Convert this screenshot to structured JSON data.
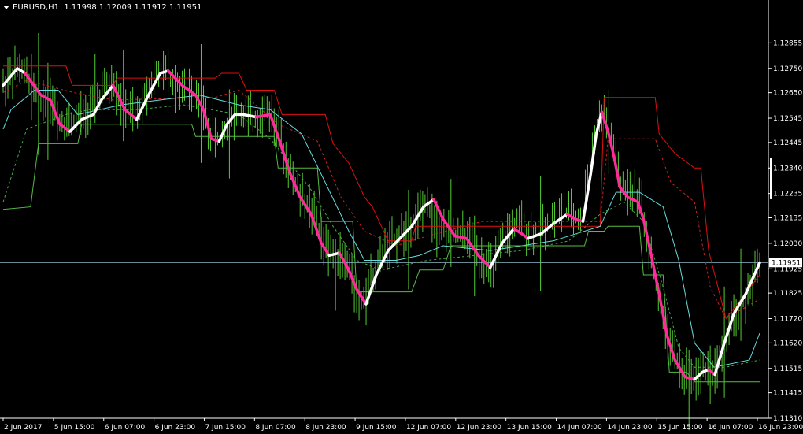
{
  "header": {
    "symbol": "EURUSD,H1",
    "ohlc": "1.11998 1.12009 1.11912 1.11951"
  },
  "colors": {
    "background": "#000000",
    "axis": "#ffffff",
    "bars": "#55cc33",
    "hline": "#8fb8c8",
    "upper_band": "#dd1111",
    "upper_mid": "#cc2222",
    "mid_band": "#66dddd",
    "lower_mid": "#44aa44",
    "lower_band": "#55bb44",
    "trend_down": "#ff2a9a",
    "trend_up": "#ffffff",
    "price_tag_bg": "#ffffff"
  },
  "chart_data": {
    "type": "line",
    "xlim": [
      0,
      966
    ],
    "ylim": [
      1.1131,
      1.1296
    ],
    "y_ticks": [
      "1.12855",
      "1.12750",
      "1.12650",
      "1.12545",
      "1.12445",
      "1.12340",
      "1.12235",
      "1.12135",
      "1.12030",
      "1.11925",
      "1.11825",
      "1.11720",
      "1.11620",
      "1.11515",
      "1.11415",
      "1.11310"
    ],
    "x_ticks": [
      {
        "x": 0,
        "label": "2 Jun 2017"
      },
      {
        "x": 64,
        "label": "5 Jun 15:00"
      },
      {
        "x": 128,
        "label": "6 Jun 07:00"
      },
      {
        "x": 192,
        "label": "6 Jun 23:00"
      },
      {
        "x": 256,
        "label": "7 Jun 15:00"
      },
      {
        "x": 320,
        "label": "8 Jun 07:00"
      },
      {
        "x": 384,
        "label": "8 Jun 23:00"
      },
      {
        "x": 448,
        "label": "9 Jun 15:00"
      },
      {
        "x": 512,
        "label": "12 Jun 07:00"
      },
      {
        "x": 576,
        "label": "12 Jun 23:00"
      },
      {
        "x": 640,
        "label": "13 Jun 15:00"
      },
      {
        "x": 704,
        "label": "14 Jun 07:00"
      },
      {
        "x": 768,
        "label": "14 Jun 23:00"
      },
      {
        "x": 832,
        "label": "15 Jun 15:00"
      },
      {
        "x": 896,
        "label": "16 Jun 07:00"
      },
      {
        "x": 960,
        "label": "16 Jun 23:00"
      }
    ],
    "current_price": 1.11951,
    "current_price_label": "1.11951",
    "price_path": [
      [
        0,
        1.1268
      ],
      [
        18,
        1.1275
      ],
      [
        30,
        1.1272
      ],
      [
        48,
        1.1262
      ],
      [
        60,
        1.1262
      ],
      [
        70,
        1.1254
      ],
      [
        85,
        1.1252
      ],
      [
        100,
        1.1256
      ],
      [
        115,
        1.126
      ],
      [
        125,
        1.1265
      ],
      [
        140,
        1.1268
      ],
      [
        155,
        1.1258
      ],
      [
        170,
        1.1256
      ],
      [
        185,
        1.1268
      ],
      [
        200,
        1.1274
      ],
      [
        212,
        1.1272
      ],
      [
        228,
        1.1266
      ],
      [
        240,
        1.1266
      ],
      [
        252,
        1.1262
      ],
      [
        262,
        1.1248
      ],
      [
        275,
        1.1245
      ],
      [
        290,
        1.1256
      ],
      [
        305,
        1.1256
      ],
      [
        320,
        1.1254
      ],
      [
        340,
        1.1258
      ],
      [
        350,
        1.1248
      ],
      [
        365,
        1.1233
      ],
      [
        378,
        1.1222
      ],
      [
        392,
        1.1218
      ],
      [
        405,
        1.1205
      ],
      [
        415,
        1.1199
      ],
      [
        425,
        1.1199
      ],
      [
        440,
        1.1192
      ],
      [
        455,
        1.1178
      ],
      [
        470,
        1.119
      ],
      [
        485,
        1.12
      ],
      [
        500,
        1.1205
      ],
      [
        515,
        1.121
      ],
      [
        535,
        1.1218
      ],
      [
        550,
        1.1214
      ],
      [
        565,
        1.1208
      ],
      [
        580,
        1.1206
      ],
      [
        595,
        1.1205
      ],
      [
        610,
        1.1196
      ],
      [
        622,
        1.1192
      ],
      [
        640,
        1.1206
      ],
      [
        655,
        1.1212
      ],
      [
        668,
        1.1208
      ],
      [
        680,
        1.1208
      ],
      [
        695,
        1.1212
      ],
      [
        710,
        1.1216
      ],
      [
        725,
        1.1215
      ],
      [
        735,
        1.1212
      ],
      [
        745,
        1.1232
      ],
      [
        755,
        1.125
      ],
      [
        765,
        1.1257
      ],
      [
        775,
        1.1245
      ],
      [
        785,
        1.1226
      ],
      [
        800,
        1.1225
      ],
      [
        812,
        1.122
      ],
      [
        822,
        1.12
      ],
      [
        835,
        1.118
      ],
      [
        850,
        1.116
      ],
      [
        865,
        1.115
      ],
      [
        880,
        1.1148
      ],
      [
        895,
        1.1152
      ],
      [
        905,
        1.115
      ],
      [
        918,
        1.1162
      ],
      [
        935,
        1.1175
      ],
      [
        950,
        1.1183
      ],
      [
        963,
        1.1195
      ]
    ],
    "trend_segments": [
      {
        "dir": "up",
        "points": [
          [
            0,
            1.1268
          ],
          [
            18,
            1.1275
          ],
          [
            28,
            1.1273
          ]
        ]
      },
      {
        "dir": "down",
        "points": [
          [
            28,
            1.1273
          ],
          [
            48,
            1.1264
          ],
          [
            60,
            1.1262
          ],
          [
            72,
            1.1252
          ],
          [
            85,
            1.1249
          ]
        ]
      },
      {
        "dir": "up",
        "points": [
          [
            85,
            1.1249
          ],
          [
            100,
            1.1254
          ],
          [
            115,
            1.1256
          ],
          [
            125,
            1.1262
          ],
          [
            140,
            1.1268
          ]
        ]
      },
      {
        "dir": "down",
        "points": [
          [
            140,
            1.1268
          ],
          [
            155,
            1.1258
          ],
          [
            170,
            1.1254
          ]
        ]
      },
      {
        "dir": "up",
        "points": [
          [
            170,
            1.1254
          ],
          [
            185,
            1.1264
          ],
          [
            200,
            1.1273
          ],
          [
            210,
            1.1274
          ]
        ]
      },
      {
        "dir": "down",
        "points": [
          [
            210,
            1.1274
          ],
          [
            228,
            1.1268
          ],
          [
            245,
            1.1264
          ],
          [
            255,
            1.1258
          ],
          [
            265,
            1.1246
          ],
          [
            275,
            1.1245
          ]
        ]
      },
      {
        "dir": "up",
        "points": [
          [
            275,
            1.1245
          ],
          [
            285,
            1.1252
          ],
          [
            295,
            1.1256
          ],
          [
            305,
            1.1256
          ],
          [
            322,
            1.1255
          ]
        ]
      },
      {
        "dir": "down",
        "points": [
          [
            322,
            1.1255
          ],
          [
            340,
            1.1256
          ],
          [
            352,
            1.1245
          ],
          [
            365,
            1.1232
          ],
          [
            378,
            1.1222
          ],
          [
            392,
            1.1215
          ],
          [
            405,
            1.1203
          ],
          [
            415,
            1.1198
          ]
        ]
      },
      {
        "dir": "up",
        "points": [
          [
            415,
            1.1198
          ],
          [
            428,
            1.1199
          ]
        ]
      },
      {
        "dir": "down",
        "points": [
          [
            428,
            1.1199
          ],
          [
            440,
            1.1192
          ],
          [
            450,
            1.1184
          ],
          [
            462,
            1.1178
          ]
        ]
      },
      {
        "dir": "up",
        "points": [
          [
            462,
            1.1178
          ],
          [
            475,
            1.119
          ],
          [
            490,
            1.12
          ],
          [
            505,
            1.1205
          ],
          [
            520,
            1.121
          ],
          [
            535,
            1.1218
          ],
          [
            548,
            1.1221
          ]
        ]
      },
      {
        "dir": "down",
        "points": [
          [
            548,
            1.1221
          ],
          [
            560,
            1.1213
          ],
          [
            575,
            1.1206
          ],
          [
            590,
            1.1205
          ],
          [
            605,
            1.1198
          ],
          [
            620,
            1.1193
          ]
        ]
      },
      {
        "dir": "up",
        "points": [
          [
            620,
            1.1193
          ],
          [
            635,
            1.1203
          ],
          [
            650,
            1.1209
          ]
        ]
      },
      {
        "dir": "down",
        "points": [
          [
            650,
            1.1209
          ],
          [
            660,
            1.1207
          ],
          [
            668,
            1.1205
          ]
        ]
      },
      {
        "dir": "up",
        "points": [
          [
            668,
            1.1205
          ],
          [
            685,
            1.1207
          ],
          [
            700,
            1.1211
          ],
          [
            718,
            1.1215
          ]
        ]
      },
      {
        "dir": "down",
        "points": [
          [
            718,
            1.1215
          ],
          [
            728,
            1.1213
          ],
          [
            738,
            1.1212
          ]
        ]
      },
      {
        "dir": "up",
        "points": [
          [
            738,
            1.1212
          ],
          [
            748,
            1.1232
          ],
          [
            755,
            1.1248
          ],
          [
            762,
            1.1257
          ]
        ]
      },
      {
        "dir": "down",
        "points": [
          [
            762,
            1.1257
          ],
          [
            770,
            1.1249
          ],
          [
            778,
            1.1238
          ],
          [
            785,
            1.1226
          ],
          [
            795,
            1.1222
          ],
          [
            808,
            1.122
          ],
          [
            815,
            1.1213
          ],
          [
            825,
            1.1198
          ],
          [
            835,
            1.1182
          ],
          [
            845,
            1.1165
          ],
          [
            855,
            1.1155
          ],
          [
            868,
            1.1148
          ],
          [
            880,
            1.1147
          ]
        ]
      },
      {
        "dir": "up",
        "points": [
          [
            880,
            1.1147
          ],
          [
            890,
            1.115
          ],
          [
            898,
            1.1151
          ]
        ]
      },
      {
        "dir": "down",
        "points": [
          [
            898,
            1.1151
          ],
          [
            906,
            1.1149
          ]
        ]
      },
      {
        "dir": "up",
        "points": [
          [
            906,
            1.1149
          ],
          [
            918,
            1.1162
          ],
          [
            930,
            1.1174
          ],
          [
            945,
            1.1182
          ],
          [
            963,
            1.1195
          ]
        ]
      }
    ],
    "bands": {
      "upper": [
        [
          0,
          1.1276
        ],
        [
          80,
          1.1276
        ],
        [
          88,
          1.1268
        ],
        [
          140,
          1.1268
        ],
        [
          145,
          1.1271
        ],
        [
          270,
          1.1271
        ],
        [
          278,
          1.1273
        ],
        [
          300,
          1.1273
        ],
        [
          310,
          1.1266
        ],
        [
          345,
          1.1266
        ],
        [
          355,
          1.1256
        ],
        [
          410,
          1.1256
        ],
        [
          420,
          1.1244
        ],
        [
          440,
          1.1236
        ],
        [
          460,
          1.1222
        ],
        [
          470,
          1.1218
        ],
        [
          490,
          1.1204
        ],
        [
          520,
          1.1204
        ],
        [
          525,
          1.121
        ],
        [
          760,
          1.121
        ],
        [
          765,
          1.1263
        ],
        [
          830,
          1.1263
        ],
        [
          835,
          1.1248
        ],
        [
          855,
          1.124
        ],
        [
          880,
          1.1234
        ],
        [
          888,
          1.1234
        ],
        [
          898,
          1.12
        ],
        [
          920,
          1.1172
        ],
        [
          963,
          1.119
        ]
      ],
      "upper_mid": [
        [
          0,
          1.1265
        ],
        [
          30,
          1.127
        ],
        [
          90,
          1.1265
        ],
        [
          140,
          1.1262
        ],
        [
          270,
          1.1263
        ],
        [
          300,
          1.1266
        ],
        [
          350,
          1.1252
        ],
        [
          400,
          1.1245
        ],
        [
          430,
          1.1222
        ],
        [
          460,
          1.1208
        ],
        [
          500,
          1.1202
        ],
        [
          540,
          1.1206
        ],
        [
          610,
          1.1212
        ],
        [
          760,
          1.1212
        ],
        [
          770,
          1.1246
        ],
        [
          830,
          1.1246
        ],
        [
          850,
          1.1228
        ],
        [
          880,
          1.122
        ],
        [
          900,
          1.1185
        ],
        [
          920,
          1.1172
        ],
        [
          963,
          1.118
        ]
      ],
      "mid": [
        [
          0,
          1.125
        ],
        [
          10,
          1.1258
        ],
        [
          40,
          1.1266
        ],
        [
          70,
          1.1266
        ],
        [
          95,
          1.1256
        ],
        [
          150,
          1.126
        ],
        [
          250,
          1.1264
        ],
        [
          300,
          1.126
        ],
        [
          340,
          1.1258
        ],
        [
          380,
          1.1248
        ],
        [
          410,
          1.1228
        ],
        [
          440,
          1.1208
        ],
        [
          460,
          1.1196
        ],
        [
          500,
          1.1196
        ],
        [
          530,
          1.1198
        ],
        [
          560,
          1.1202
        ],
        [
          620,
          1.12
        ],
        [
          700,
          1.1204
        ],
        [
          760,
          1.121
        ],
        [
          780,
          1.1224
        ],
        [
          810,
          1.1224
        ],
        [
          840,
          1.1218
        ],
        [
          860,
          1.1196
        ],
        [
          880,
          1.1162
        ],
        [
          905,
          1.1152
        ],
        [
          950,
          1.1155
        ],
        [
          963,
          1.1166
        ]
      ],
      "lower_mid": [
        [
          0,
          1.122
        ],
        [
          10,
          1.123
        ],
        [
          30,
          1.125
        ],
        [
          80,
          1.1256
        ],
        [
          110,
          1.1258
        ],
        [
          170,
          1.1258
        ],
        [
          230,
          1.126
        ],
        [
          300,
          1.1256
        ],
        [
          340,
          1.1246
        ],
        [
          390,
          1.1226
        ],
        [
          420,
          1.121
        ],
        [
          450,
          1.1196
        ],
        [
          480,
          1.1192
        ],
        [
          540,
          1.1196
        ],
        [
          600,
          1.1198
        ],
        [
          660,
          1.12
        ],
        [
          720,
          1.1204
        ],
        [
          760,
          1.1215
        ],
        [
          790,
          1.122
        ],
        [
          815,
          1.1212
        ],
        [
          840,
          1.1185
        ],
        [
          860,
          1.116
        ],
        [
          880,
          1.1152
        ],
        [
          920,
          1.1152
        ],
        [
          963,
          1.1155
        ]
      ],
      "lower": [
        [
          0,
          1.1217
        ],
        [
          35,
          1.1218
        ],
        [
          45,
          1.1244
        ],
        [
          95,
          1.1244
        ],
        [
          100,
          1.1252
        ],
        [
          240,
          1.1252
        ],
        [
          245,
          1.1247
        ],
        [
          345,
          1.1247
        ],
        [
          350,
          1.1234
        ],
        [
          400,
          1.1234
        ],
        [
          405,
          1.1212
        ],
        [
          445,
          1.1212
        ],
        [
          450,
          1.1183
        ],
        [
          520,
          1.1183
        ],
        [
          530,
          1.1192
        ],
        [
          560,
          1.1192
        ],
        [
          570,
          1.1202
        ],
        [
          740,
          1.1202
        ],
        [
          745,
          1.1208
        ],
        [
          765,
          1.1208
        ],
        [
          770,
          1.121
        ],
        [
          810,
          1.121
        ],
        [
          815,
          1.119
        ],
        [
          840,
          1.119
        ],
        [
          848,
          1.115
        ],
        [
          870,
          1.115
        ],
        [
          880,
          1.1146
        ],
        [
          963,
          1.1146
        ]
      ]
    },
    "bars": []
  }
}
